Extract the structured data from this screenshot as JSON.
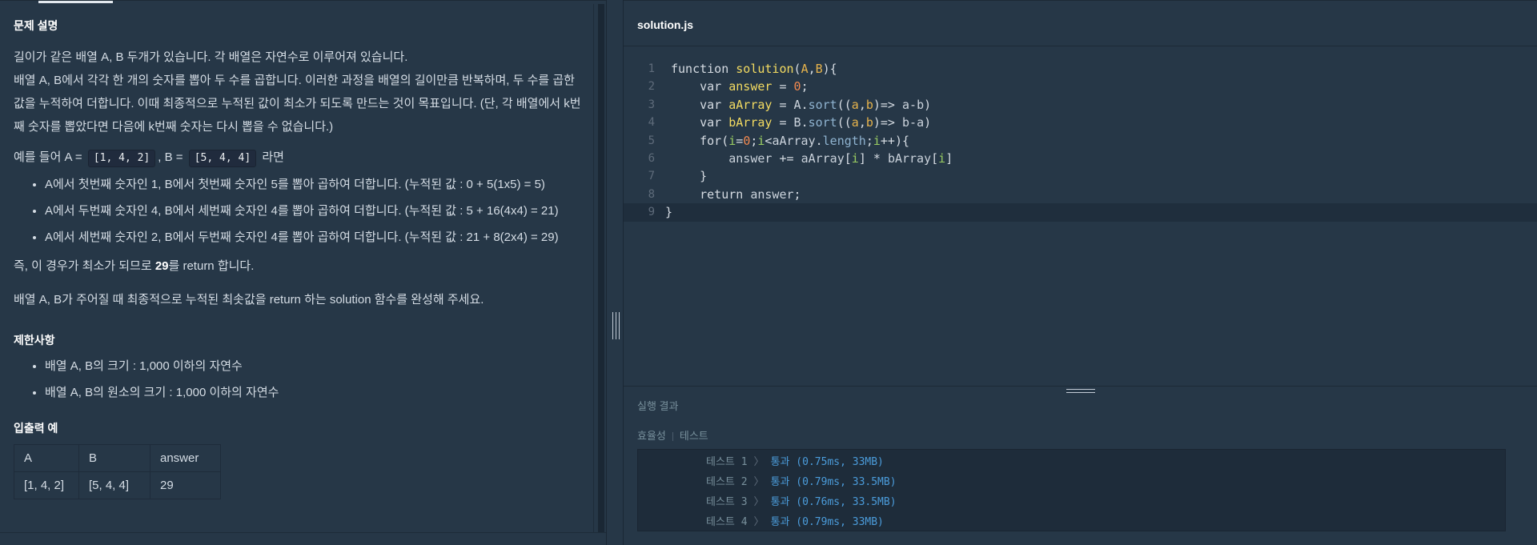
{
  "left": {
    "section_title": "문제 설명",
    "paragraphs": [
      "길이가 같은 배열 A, B 두개가 있습니다. 각 배열은 자연수로 이루어져 있습니다.",
      "배열 A, B에서 각각 한 개의 숫자를 뽑아 두 수를 곱합니다. 이러한 과정을 배열의 길이만큼 반복하며, 두 수를 곱한 값을 누적하여 더합니다. 이때 최종적으로 누적된 값이 최소가 되도록 만드는 것이 목표입니다. (단, 각 배열에서 k번째 숫자를 뽑았다면 다음에 k번째 숫자는 다시 뽑을 수 없습니다.)"
    ],
    "example": {
      "prefix": "예를 들어 A = ",
      "a_code": "[1, 4, 2]",
      "middle": ", B = ",
      "b_code": "[5, 4, 4]",
      "suffix": " 라면"
    },
    "bullets": [
      "A에서 첫번째 숫자인 1, B에서 첫번째 숫자인 5를 뽑아 곱하여 더합니다. (누적된 값 : 0 + 5(1x5) = 5)",
      "A에서 두번째 숫자인 4, B에서 세번째 숫자인 4를 뽑아 곱하여 더합니다. (누적된 값 : 5 + 16(4x4) = 21)",
      "A에서 세번째 숫자인 2, B에서 두번째 숫자인 4를 뽑아 곱하여 더합니다. (누적된 값 : 21 + 8(2x4) = 29)"
    ],
    "conclusion_prefix": "즉, 이 경우가 최소가 되므로 ",
    "conclusion_bold": "29",
    "conclusion_suffix": "를 return 합니다.",
    "task": "배열 A, B가 주어질 때 최종적으로 누적된 최솟값을 return 하는 solution 함수를 완성해 주세요.",
    "constraints_title": "제한사항",
    "constraints": [
      "배열 A, B의 크기 : 1,000 이하의 자연수",
      "배열 A, B의 원소의 크기 : 1,000 이하의 자연수"
    ],
    "io_title": "입출력 예",
    "io_table": {
      "headers": [
        "A",
        "B",
        "answer"
      ],
      "rows": [
        [
          "[1, 4, 2]",
          "[5, 4, 4]",
          "29"
        ]
      ]
    }
  },
  "editor": {
    "file_name": "solution.js",
    "line_numbers": [
      "1",
      "2",
      "3",
      "4",
      "5",
      "6",
      "7",
      "8",
      "9"
    ]
  },
  "results": {
    "title": "실행 결과",
    "tab_efficiency": "효율성",
    "tab_test": "테스트",
    "rows": [
      {
        "name": "테스트 1",
        "status": "통과 (0.75ms, 33MB)"
      },
      {
        "name": "테스트 2",
        "status": "통과 (0.79ms, 33.5MB)"
      },
      {
        "name": "테스트 3",
        "status": "통과 (0.76ms, 33.5MB)"
      },
      {
        "name": "테스트 4",
        "status": "통과 (0.79ms, 33MB)"
      }
    ]
  }
}
